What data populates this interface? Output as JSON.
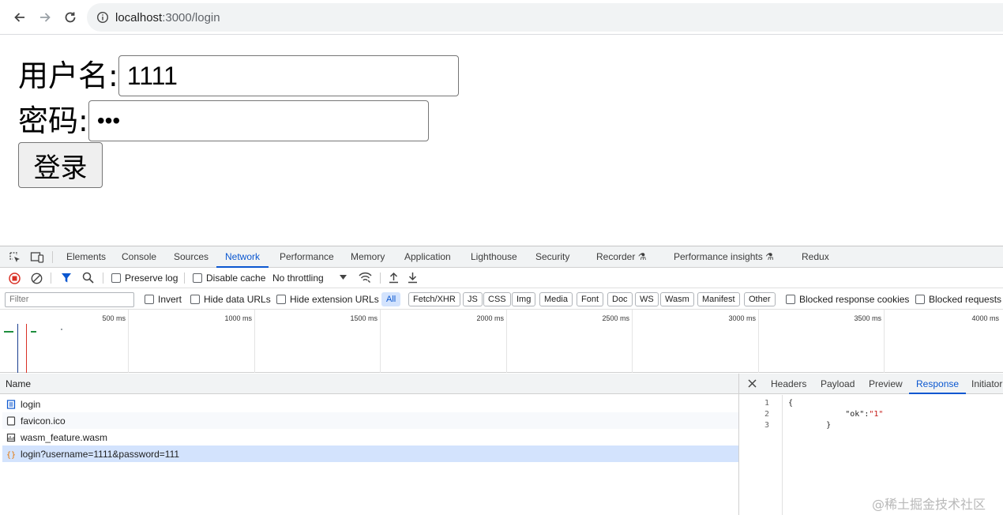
{
  "browser": {
    "url_host": "localhost",
    "url_rest": ":3000/login"
  },
  "page": {
    "username_label": "用户名:",
    "username_value": "1111",
    "password_label": "密码:",
    "password_value": "•••",
    "login_button": "登录"
  },
  "devtools": {
    "tabs": [
      "Elements",
      "Console",
      "Sources",
      "Network",
      "Performance",
      "Memory",
      "Application",
      "Lighthouse",
      "Security",
      "Recorder",
      "Performance insights",
      "Redux"
    ],
    "active_tab": "Network",
    "toolbar": {
      "preserve_log": "Preserve log",
      "disable_cache": "Disable cache",
      "throttling": "No throttling"
    },
    "filters": {
      "filter_placeholder": "Filter",
      "invert": "Invert",
      "hide_data_urls": "Hide data URLs",
      "hide_extension_urls": "Hide extension URLs",
      "types": [
        "All",
        "Fetch/XHR",
        "JS",
        "CSS",
        "Img",
        "Media",
        "Font",
        "Doc",
        "WS",
        "Wasm",
        "Manifest",
        "Other"
      ],
      "selected_type": "All",
      "blocked_response_cookies": "Blocked response cookies",
      "blocked_requests": "Blocked requests"
    },
    "timeline_ticks": [
      "500 ms",
      "1000 ms",
      "1500 ms",
      "2000 ms",
      "2500 ms",
      "3000 ms",
      "3500 ms",
      "4000 ms"
    ],
    "request_list": {
      "column_name": "Name",
      "rows": [
        {
          "name": "login",
          "icon": "document-icon"
        },
        {
          "name": "favicon.ico",
          "icon": "other-file-icon"
        },
        {
          "name": "wasm_feature.wasm",
          "icon": "wasm-icon"
        },
        {
          "name": "login?username=1111&password=111",
          "icon": "xhr-icon"
        }
      ],
      "selected_index": 3
    },
    "detail": {
      "tabs": [
        "Headers",
        "Payload",
        "Preview",
        "Response",
        "Initiator"
      ],
      "active_tab": "Response",
      "line_numbers": [
        "1",
        "2",
        "3"
      ],
      "response_lines": [
        "{",
        "            \"ok\":\"1\"",
        "        }"
      ]
    }
  },
  "watermark": "@稀土掘金技术社区",
  "colors": {
    "accent": "#0b57d0",
    "selected_row": "#d3e3fd",
    "record_red": "#d93025"
  }
}
